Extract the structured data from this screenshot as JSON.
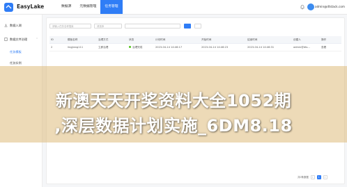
{
  "app": {
    "brand": "EasyLake",
    "nav": [
      "数据源",
      "元数据管理",
      "任务管理"
    ],
    "active_nav_index": 2,
    "user_email": "admin@dtstack.com",
    "accent": "#2f7df6"
  },
  "sidebar": {
    "items": [
      {
        "label": "数据入湖",
        "icon": "download-icon"
      },
      {
        "label": "数据文件治理",
        "icon": "document-icon",
        "expanded": true
      }
    ],
    "sub_items": [
      {
        "label": "任务模板"
      },
      {
        "label": "任务实例"
      }
    ],
    "active_sub_index": 0
  },
  "filters": {
    "name_placeholder": "请输入任务名称搜索",
    "select_placeholder": "请选择"
  },
  "table": {
    "headers": [
      "ID",
      "模板名称",
      "治理方式",
      "状态",
      "计划时间",
      "开始时间",
      "结束时间",
      "创建人",
      "操作"
    ],
    "rows": [
      [
        "2",
        "lingjiang111",
        "立即治理",
        "治理完成",
        "2023-04-14 14:46:17",
        "2023-04-14 14:46:23",
        "2023-04-14 14:46:31",
        "admin@dts...",
        "查看"
      ]
    ]
  },
  "pagination": {
    "total": "共0条数据",
    "current_page": "1"
  },
  "watermark": {
    "line1": "新澳天天开奖资料大全1052期",
    "line2": ",深层数据计划实施_6DM8.18"
  }
}
